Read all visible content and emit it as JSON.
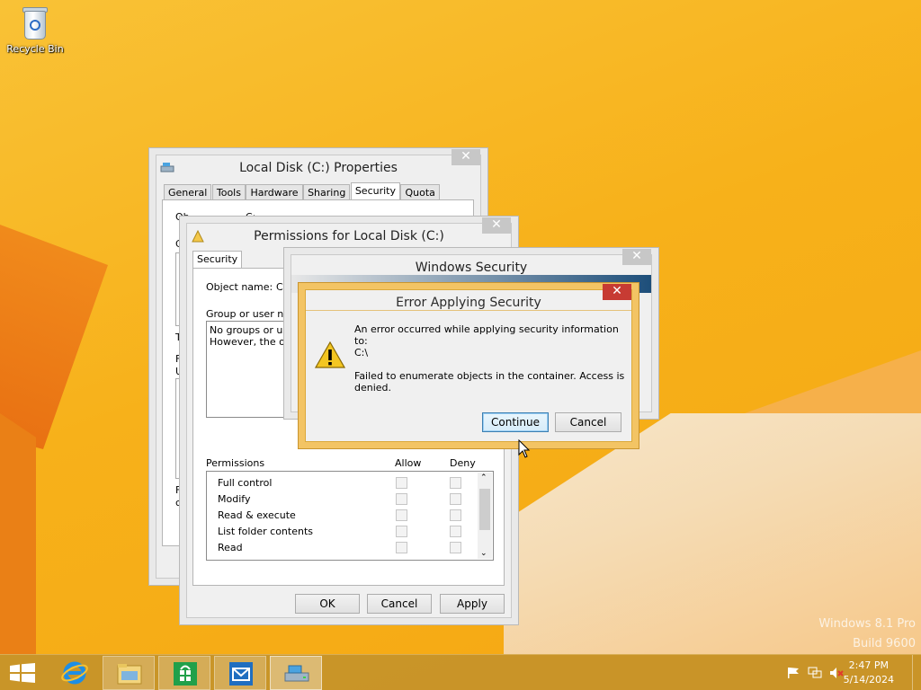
{
  "desktop": {
    "recycle_bin_label": "Recycle Bin",
    "watermark_line1": "Windows 8.1 Pro",
    "watermark_line2": "Build 9600"
  },
  "props_window": {
    "title": "Local Disk (C:) Properties",
    "close": "✕",
    "tabs": [
      "General",
      "Tools",
      "Hardware",
      "Sharing",
      "Security",
      "Quota"
    ],
    "active_tab": "Security",
    "fragments": [
      "Ob",
      "C:",
      "G",
      "T",
      "F",
      "U",
      "F",
      "c"
    ]
  },
  "perm_window": {
    "title": "Permissions for Local Disk (C:)",
    "close": "✕",
    "tab": "Security",
    "object_name_label": "Object name:",
    "object_name_value": "C",
    "group_label": "Group or user nam",
    "group_text_line1": "No groups or user",
    "group_text_line2": "However, the own",
    "permissions_header": "Permissions",
    "allow_header": "Allow",
    "deny_header": "Deny",
    "rows": [
      "Full control",
      "Modify",
      "Read & execute",
      "List folder contents",
      "Read"
    ],
    "ok": "OK",
    "cancel": "Cancel",
    "apply": "Apply"
  },
  "wsec_window": {
    "title": "Windows Security",
    "close": "✕"
  },
  "error_dialog": {
    "title": "Error Applying Security",
    "close": "✕",
    "message_line1": "An error occurred while applying security information to:",
    "path": "C:\\",
    "message_line2": "Failed to enumerate objects in the container. Access is denied.",
    "continue_label": "Continue",
    "cancel_label": "Cancel"
  },
  "taskbar": {
    "items": [
      "start-icon",
      "internet-explorer-icon",
      "file-explorer-icon",
      "store-icon",
      "mail-icon",
      "drive-icon"
    ],
    "time": "2:47 PM",
    "date": "5/14/2024"
  },
  "colors": {
    "desktop": "#f7b11a",
    "error_frame": "#f3c464",
    "close_red": "#c73b33",
    "taskbar": "#c4922a"
  }
}
